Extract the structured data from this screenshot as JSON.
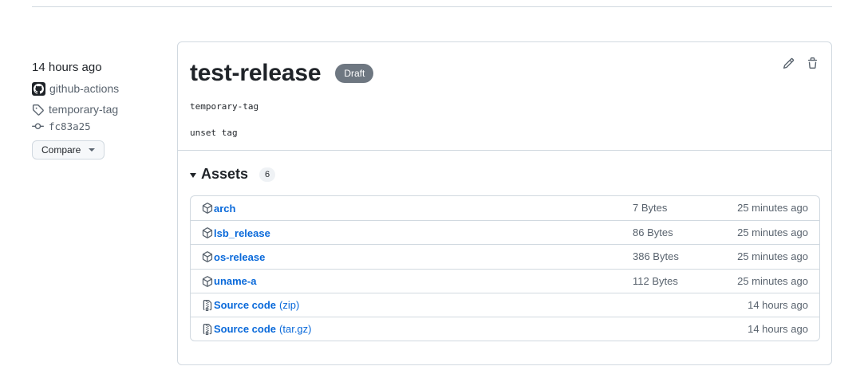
{
  "sidebar": {
    "time": "14 hours ago",
    "author": "github-actions",
    "tag": "temporary-tag",
    "commit": "fc83a25",
    "compare_label": "Compare"
  },
  "release": {
    "title": "test-release",
    "badge": "Draft",
    "body": [
      "temporary-tag",
      "unset tag"
    ],
    "edit_icon": "pencil-icon",
    "delete_icon": "trash-icon"
  },
  "assets": {
    "title": "Assets",
    "count": "6",
    "items": [
      {
        "name": "arch",
        "ext": "",
        "size": "7 Bytes",
        "date": "25 minutes ago",
        "icon": "package-icon"
      },
      {
        "name": "lsb_release",
        "ext": "",
        "size": "86 Bytes",
        "date": "25 minutes ago",
        "icon": "package-icon"
      },
      {
        "name": "os-release",
        "ext": "",
        "size": "386 Bytes",
        "date": "25 minutes ago",
        "icon": "package-icon"
      },
      {
        "name": "uname-a",
        "ext": "",
        "size": "112 Bytes",
        "date": "25 minutes ago",
        "icon": "package-icon"
      },
      {
        "name": "Source code",
        "ext": "(zip)",
        "size": "",
        "date": "14 hours ago",
        "icon": "file-zip-icon"
      },
      {
        "name": "Source code",
        "ext": "(tar.gz)",
        "size": "",
        "date": "14 hours ago",
        "icon": "file-zip-icon"
      }
    ]
  },
  "colors": {
    "link": "#0969da",
    "muted": "#59636e",
    "border": "#d1d9e0",
    "draft_badge": "#6e7781"
  }
}
